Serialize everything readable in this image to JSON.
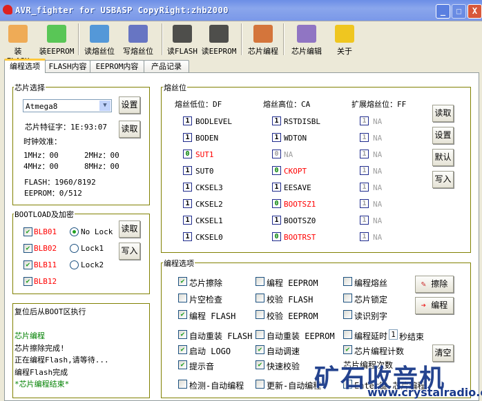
{
  "window": {
    "title": "AVR_fighter for USBASP CopyRight:zhb2000",
    "min": "_",
    "max": "□",
    "close": "X"
  },
  "toolbar": [
    {
      "label": "装FLASH",
      "icon": "folder-orange-icon"
    },
    {
      "label": "装EEPROM",
      "icon": "folder-green-icon"
    },
    {
      "label": "读熔丝位",
      "icon": "read-fuse-icon"
    },
    {
      "label": "写熔丝位",
      "icon": "write-fuse-icon"
    },
    {
      "label": "读FLASH",
      "icon": "chip-large-icon"
    },
    {
      "label": "读EEPROM",
      "icon": "chip-small-icon"
    },
    {
      "label": "芯片编程",
      "icon": "worker-icon"
    },
    {
      "label": "芯片编辑",
      "icon": "edit-tools-icon"
    },
    {
      "label": "关于",
      "icon": "info-icon"
    }
  ],
  "tabs": [
    "编程选项",
    "FLASH内容",
    "EEPROM内容",
    "产品记录"
  ],
  "chip": {
    "title": "芯片选择",
    "selected": "Atmega8",
    "set": "设置",
    "read": "读取",
    "signature": "芯片特征字：1E:93:07",
    "clock_title": "时钟效准：",
    "c1": "1MHz：00",
    "c2": "2MHz：00",
    "c4": "4MHz：00",
    "c8": "8MHz：00",
    "flash": "FLASH：1960/8192",
    "eeprom": "EEPROM：0/512"
  },
  "boot": {
    "title": "BOOTLOAD及加密",
    "read": "读取",
    "write": "写入",
    "bits": [
      {
        "label": "BLB01",
        "checked": true
      },
      {
        "label": "BLB02",
        "checked": true
      },
      {
        "label": "BLB11",
        "checked": true
      },
      {
        "label": "BLB12",
        "checked": true
      }
    ],
    "locks": [
      {
        "label": "No Lock",
        "selected": true
      },
      {
        "label": "Lock1",
        "selected": false
      },
      {
        "label": "Lock2",
        "selected": false
      }
    ]
  },
  "log": [
    {
      "text": "复位后从BOOT区执行",
      "color": "#000"
    },
    {
      "text": "",
      "color": "#000"
    },
    {
      "text": "芯片编程",
      "color": "#008000"
    },
    {
      "text": "芯片擦除完成!",
      "color": "#000"
    },
    {
      "text": "正在编程Flash,请等待...",
      "color": "#000"
    },
    {
      "text": "编程Flash完成",
      "color": "#000"
    },
    {
      "text": "*芯片编程结束*",
      "color": "#008000"
    }
  ],
  "fuse": {
    "title": "熔丝位",
    "buttons": [
      "读取",
      "设置",
      "默认",
      "写入"
    ],
    "cols": [
      {
        "header": "熔丝低位：DF",
        "bits": [
          [
            "1",
            "BODLEVEL",
            "n"
          ],
          [
            "1",
            "BODEN",
            "n"
          ],
          [
            "0",
            "SUT1",
            "r"
          ],
          [
            "1",
            "SUT0",
            "n"
          ],
          [
            "1",
            "CKSEL3",
            "n"
          ],
          [
            "1",
            "CKSEL2",
            "n"
          ],
          [
            "1",
            "CKSEL1",
            "n"
          ],
          [
            "1",
            "CKSEL0",
            "n"
          ]
        ]
      },
      {
        "header": "熔丝高位：CA",
        "bits": [
          [
            "1",
            "RSTDISBL",
            "n"
          ],
          [
            "1",
            "WDTON",
            "n"
          ],
          [
            "0",
            "NA",
            "g"
          ],
          [
            "0",
            "CKOPT",
            "r"
          ],
          [
            "1",
            "EESAVE",
            "n"
          ],
          [
            "0",
            "BOOTSZ1",
            "r"
          ],
          [
            "1",
            "BOOTSZ0",
            "n"
          ],
          [
            "0",
            "BOOTRST",
            "r"
          ]
        ]
      },
      {
        "header": "扩展熔丝位：FF",
        "bits": [
          [
            "1",
            "NA",
            "g"
          ],
          [
            "1",
            "NA",
            "g"
          ],
          [
            "1",
            "NA",
            "g"
          ],
          [
            "1",
            "NA",
            "g"
          ],
          [
            "1",
            "NA",
            "g"
          ],
          [
            "1",
            "NA",
            "g"
          ],
          [
            "1",
            "NA",
            "g"
          ],
          [
            "1",
            "NA",
            "g"
          ]
        ]
      }
    ]
  },
  "prog": {
    "title": "编程选项",
    "erase": "擦除",
    "program": "编程",
    "clear": "清空",
    "delay_value": "1",
    "delay_suffix": "秒结束",
    "count_label": "芯片编程次数",
    "rows": [
      [
        [
          "芯片擦除",
          true
        ],
        [
          "编程 EEPROM",
          false
        ],
        [
          "编程熔丝",
          false
        ]
      ],
      [
        [
          "片空检查",
          false
        ],
        [
          "校验 FLASH",
          false
        ],
        [
          "芯片锁定",
          false
        ]
      ],
      [
        [
          "编程 FLASH",
          true
        ],
        [
          "校验 EEPROM",
          false
        ],
        [
          "读识别字",
          false
        ]
      ],
      [
        [
          "自动重装 FLASH",
          true
        ],
        [
          "自动重装 EEPROM",
          false
        ],
        [
          "编程延时",
          false
        ]
      ],
      [
        [
          "启动 LOGO",
          true
        ],
        [
          "自动调速",
          true
        ],
        [
          "芯片编程计数",
          true
        ]
      ],
      [
        [
          "提示音",
          true
        ],
        [
          "快速校验",
          true
        ],
        null
      ],
      [
        [
          "检测-自动编程",
          false
        ],
        [
          "更新-自动编程",
          false
        ],
        [
          "Enter键-芯片编程",
          false
        ]
      ]
    ]
  },
  "watermark": {
    "name": "矿石收音机",
    "url": "www.crystalradio.cn"
  }
}
